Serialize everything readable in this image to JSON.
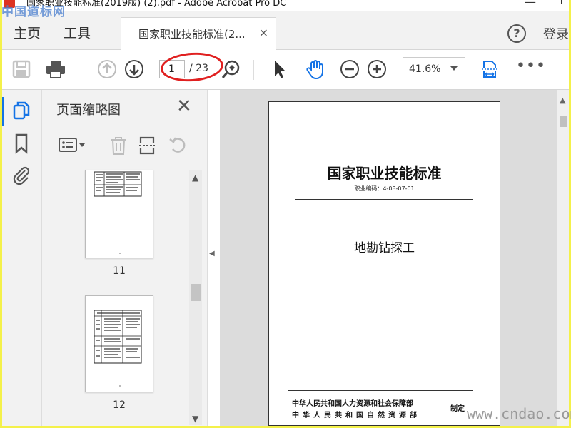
{
  "window": {
    "title": "国家职业技能标准(2019版) (2).pdf - Adobe Acrobat Pro DC"
  },
  "menu": {
    "home": "主页",
    "tools": "工具"
  },
  "tab": {
    "label": "国家职业技能标准(2...",
    "close": "×"
  },
  "header": {
    "help": "?",
    "login": "登录"
  },
  "toolbar": {
    "current_page": "1",
    "total_pages": "/ 23",
    "zoom": "41.6%",
    "more": "•••",
    "icons": [
      "save-icon",
      "print-icon",
      "page-up-icon",
      "page-down-icon",
      "zoom-marquee-icon",
      "select-arrow-icon",
      "hand-icon",
      "zoom-out-icon",
      "zoom-in-icon",
      "fit-page-icon",
      "more-icon"
    ]
  },
  "sidebar": {
    "icons": [
      "page-thumbnails-icon",
      "bookmark-icon",
      "attachment-icon"
    ]
  },
  "thumbnails": {
    "title": "页面缩略图",
    "close": "✕",
    "pages": [
      {
        "number": "11"
      },
      {
        "number": "12"
      }
    ]
  },
  "document": {
    "title": "国家职业技能标准",
    "code": "职业编码：4-08-07-01",
    "subtitle": "地勘钻探工",
    "org_line1": "中华人民共和国人力资源和社会保障部",
    "org_line2": "中华人民共和国自然资源部",
    "issued": "制定"
  },
  "watermarks": {
    "top_left": "中国道标网",
    "bottom_right": "www.cndao.com"
  },
  "colors": {
    "frame": "#f4f14a",
    "accent": "#1473e6",
    "annotation": "#e02020"
  }
}
